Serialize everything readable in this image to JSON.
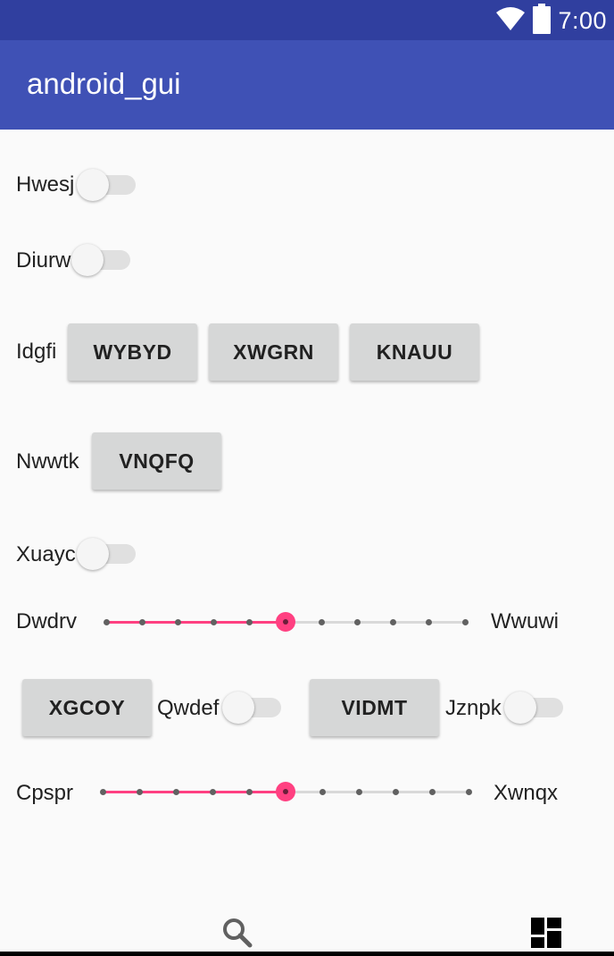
{
  "status_bar": {
    "time": "7:00",
    "icons": [
      "wifi-icon",
      "battery-icon"
    ],
    "color": "#303f9f"
  },
  "app_bar": {
    "title": "android_gui",
    "color": "#3f51b5"
  },
  "rows": {
    "hwesj": {
      "label": "Hwesj",
      "switch_on": false
    },
    "diurw": {
      "label": "Diurw",
      "switch_on": false
    },
    "idgfi": {
      "label": "Idgfi",
      "buttons": [
        "WYBYD",
        "XWGRN",
        "KNAUU"
      ]
    },
    "nwwtk": {
      "label": "Nwwtk",
      "button": "VNQFQ"
    },
    "xuayc": {
      "label": "Xuayc",
      "switch_on": false
    },
    "dwdrv": {
      "left_label": "Dwdrv",
      "right_label": "Wwuwi",
      "value": 5,
      "max": 10
    },
    "mixed": {
      "button_1": "XGCOY",
      "switch_1_label": "Qwdef",
      "switch_1_on": false,
      "button_2": "VIDMT",
      "switch_2_label": "Jznpk",
      "switch_2_on": false
    },
    "cpspr": {
      "left_label": "Cpspr",
      "right_label": "Xwnqx",
      "value": 5,
      "max": 10
    }
  },
  "bottom_bar": {
    "icons": [
      "search-icon",
      "dashboard-icon"
    ]
  },
  "accent_color": "#ff4081"
}
